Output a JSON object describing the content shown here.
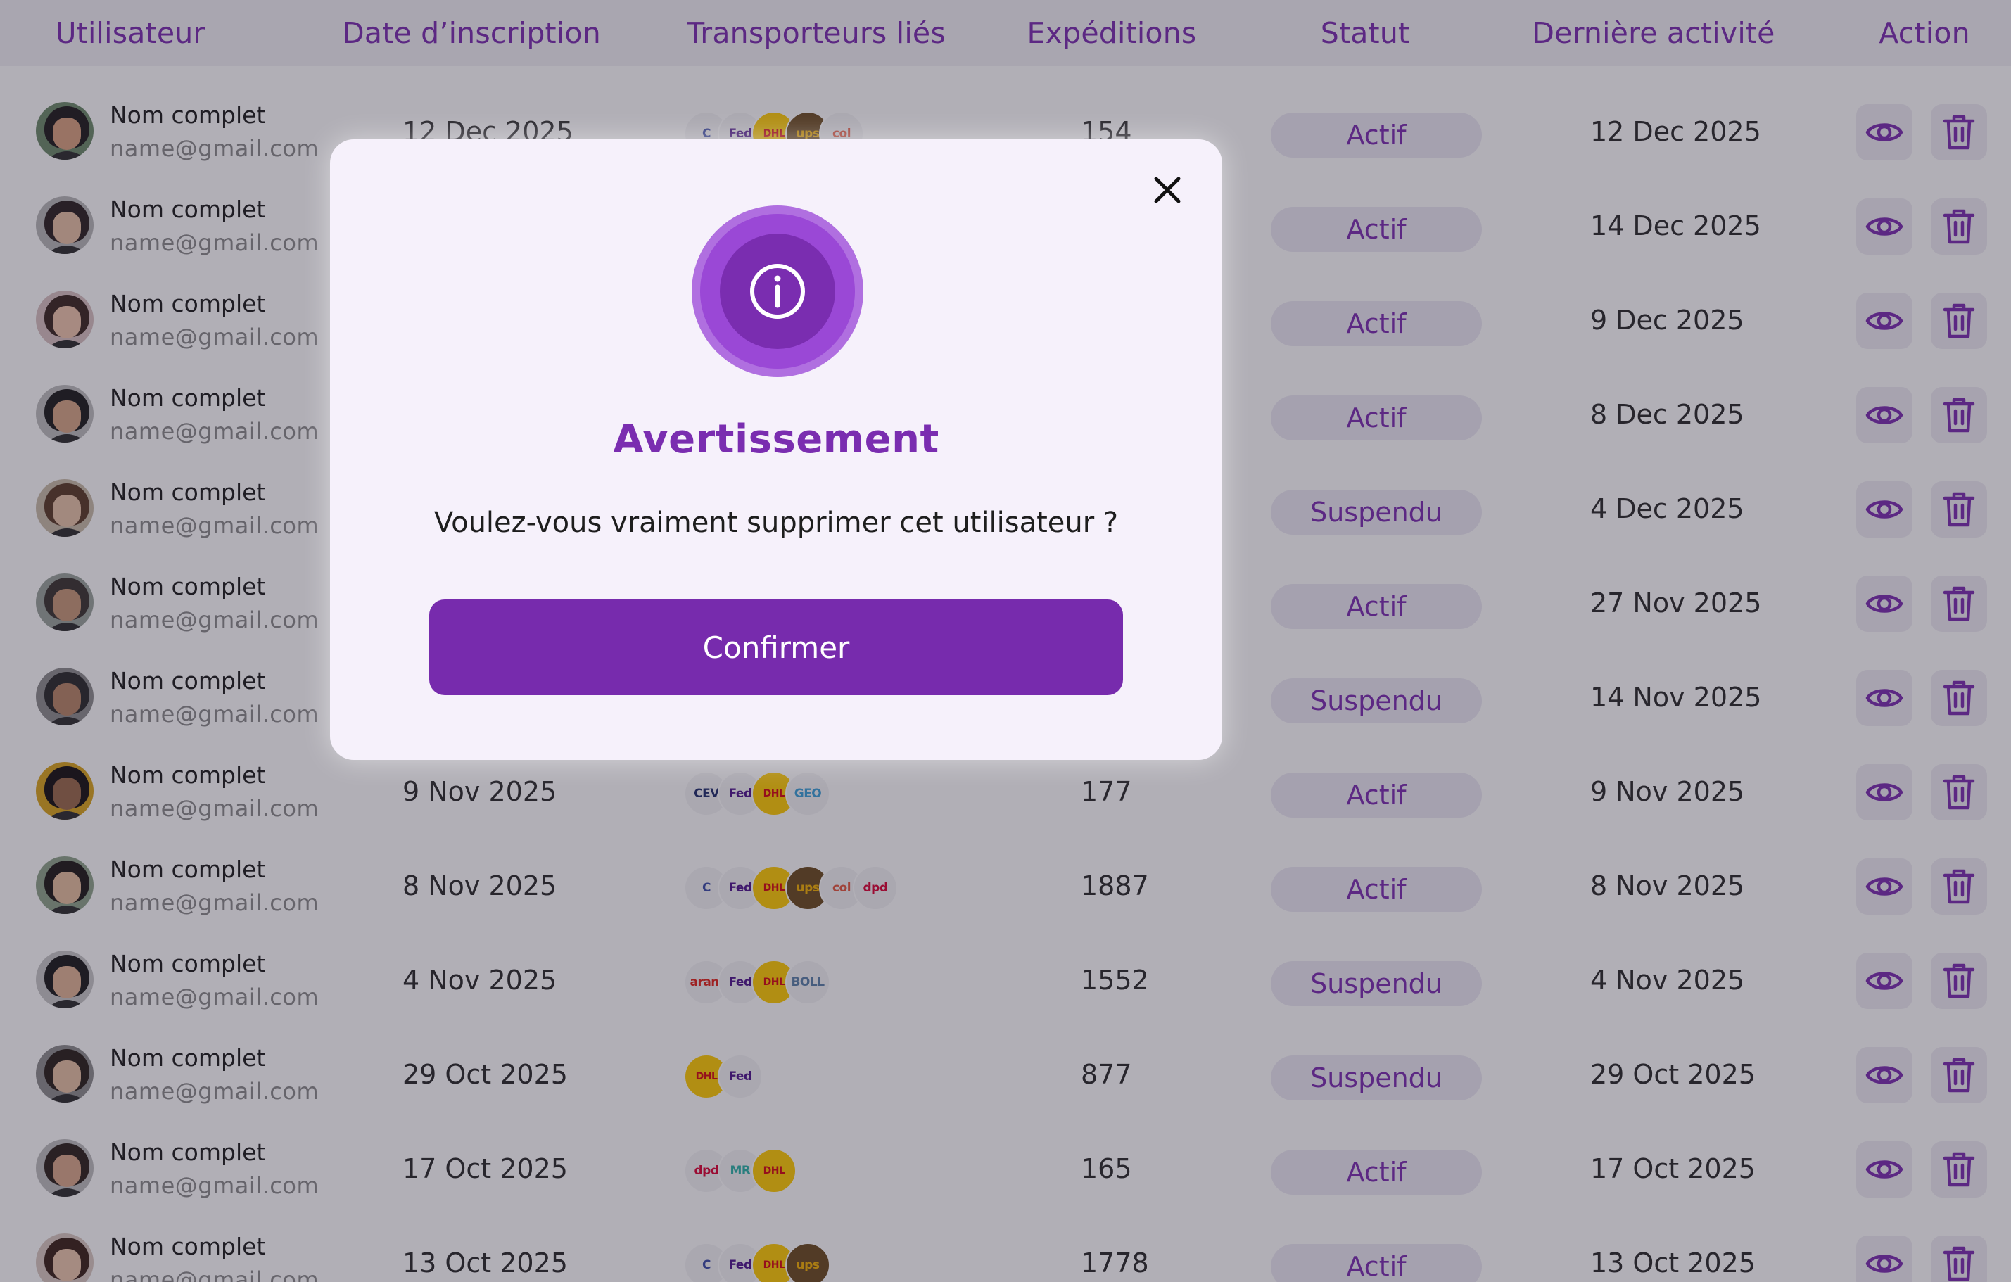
{
  "table": {
    "columns": [
      "Utilisateur",
      "Date d’inscription",
      "Transporteurs liés",
      "Expéditions",
      "Statut",
      "Dernière activité",
      "Action"
    ],
    "rows": [
      {
        "name": "Nom complet",
        "email": "name@gmail.com",
        "signup": "12 Dec 2025",
        "carriers": [
          "chronopost",
          "fedex",
          "dhl",
          "ups",
          "colissimo"
        ],
        "shipments": "154",
        "status": "Actif",
        "last_activity": "12 Dec 2025"
      },
      {
        "name": "Nom complet",
        "email": "name@gmail.com",
        "signup": "",
        "carriers": [],
        "shipments": "",
        "status": "Actif",
        "last_activity": "14 Dec 2025"
      },
      {
        "name": "Nom complet",
        "email": "name@gmail.com",
        "signup": "",
        "carriers": [],
        "shipments": "",
        "status": "Actif",
        "last_activity": "9 Dec 2025"
      },
      {
        "name": "Nom complet",
        "email": "name@gmail.com",
        "signup": "",
        "carriers": [],
        "shipments": "",
        "status": "Actif",
        "last_activity": "8 Dec 2025"
      },
      {
        "name": "Nom complet",
        "email": "name@gmail.com",
        "signup": "",
        "carriers": [],
        "shipments": "",
        "status": "Suspendu",
        "last_activity": "4 Dec 2025"
      },
      {
        "name": "Nom complet",
        "email": "name@gmail.com",
        "signup": "",
        "carriers": [],
        "shipments": "",
        "status": "Actif",
        "last_activity": "27 Nov 2025"
      },
      {
        "name": "Nom complet",
        "email": "name@gmail.com",
        "signup": "",
        "carriers": [],
        "shipments": "",
        "status": "Suspendu",
        "last_activity": "14 Nov 2025"
      },
      {
        "name": "Nom complet",
        "email": "name@gmail.com",
        "signup": "9 Nov 2025",
        "carriers": [
          "ceva",
          "fedex",
          "dhl",
          "geodis"
        ],
        "shipments": "177",
        "status": "Actif",
        "last_activity": "9 Nov 2025"
      },
      {
        "name": "Nom complet",
        "email": "name@gmail.com",
        "signup": "8 Nov 2025",
        "carriers": [
          "chronopost",
          "fedex",
          "dhl",
          "ups",
          "colissimo",
          "dpd"
        ],
        "shipments": "1887",
        "status": "Actif",
        "last_activity": "8 Nov 2025"
      },
      {
        "name": "Nom complet",
        "email": "name@gmail.com",
        "signup": "4 Nov 2025",
        "carriers": [
          "aramex",
          "fedex",
          "dhl",
          "bollore"
        ],
        "shipments": "1552",
        "status": "Suspendu",
        "last_activity": "4 Nov 2025"
      },
      {
        "name": "Nom complet",
        "email": "name@gmail.com",
        "signup": "29 Oct 2025",
        "carriers": [
          "dhl",
          "fedex"
        ],
        "shipments": "877",
        "status": "Suspendu",
        "last_activity": "29 Oct 2025"
      },
      {
        "name": "Nom complet",
        "email": "name@gmail.com",
        "signup": "17 Oct 2025",
        "carriers": [
          "dpd",
          "relay",
          "dhl"
        ],
        "shipments": "165",
        "status": "Actif",
        "last_activity": "17 Oct 2025"
      },
      {
        "name": "Nom complet",
        "email": "name@gmail.com",
        "signup": "13 Oct 2025",
        "carriers": [
          "chronopost",
          "fedex",
          "dhl",
          "ups"
        ],
        "shipments": "1778",
        "status": "Actif",
        "last_activity": "13 Oct 2025"
      }
    ]
  },
  "carrier_labels": {
    "chronopost": "C",
    "fedex": "Fed",
    "dhl": "DHL",
    "ups": "ups",
    "colissimo": "col",
    "ceva": "CEV",
    "geodis": "GEO",
    "dpd": "dpd",
    "aramex": "aram",
    "bollore": "BOLL",
    "relay": "MR"
  },
  "carrier_colors": {
    "chronopost": "#3b4ba8",
    "fedex": "#4d148c",
    "dhl": "#d40511",
    "ups": "#351c15",
    "colissimo": "#e4573d",
    "ceva": "#1f2d6b",
    "geodis": "#3aa0d8",
    "dpd": "#dc0032",
    "aramex": "#e2231a",
    "bollore": "#5a7fa8",
    "relay": "#2bb3a8"
  },
  "actions": {
    "view_icon": "eye-icon",
    "delete_icon": "trash-icon"
  },
  "modal": {
    "icon": "info-icon",
    "title": "Avertissement",
    "message": "Voulez-vous vraiment supprimer cet utilisateur ?",
    "confirm_label": "Confirmer",
    "close_icon": "close-icon"
  },
  "colors": {
    "accent": "#7a2db0",
    "status_bg": "#ece9f4",
    "modal_bg": "#f6f1fb"
  }
}
